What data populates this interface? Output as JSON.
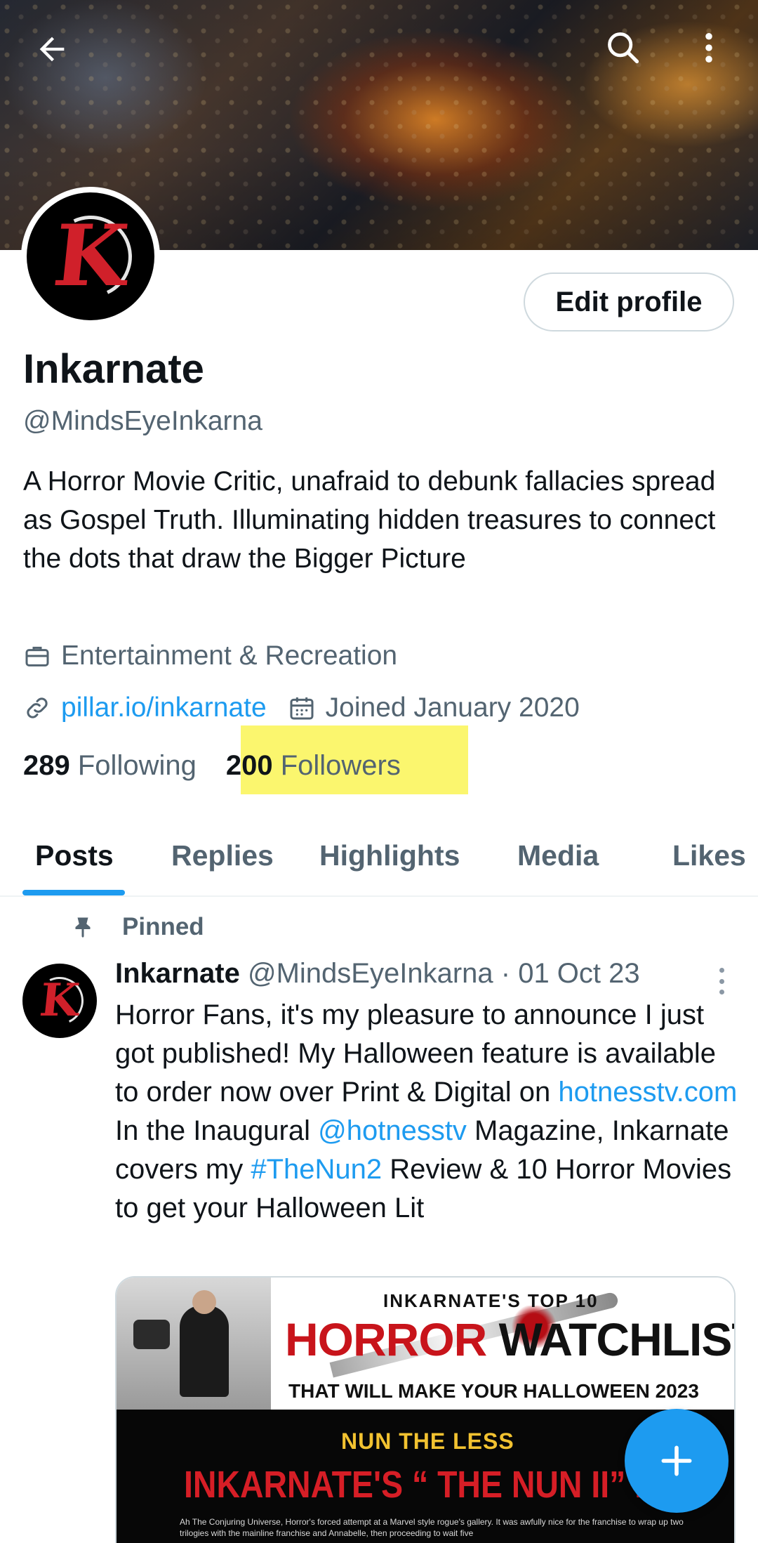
{
  "profile": {
    "name": "Inkarnate",
    "handle": "@MindsEyeInkarna",
    "bio": "A Horror Movie Critic, unafraid to debunk fallacies spread as Gospel Truth. Illuminating hidden treasures to connect the dots that draw the Bigger Picture",
    "category": "Entertainment & Recreation",
    "website": "pillar.io/inkarnate",
    "joined": "Joined January 2020",
    "following_count": "289",
    "following_label": "Following",
    "followers_count": "200",
    "followers_label": "Followers",
    "edit_button": "Edit profile",
    "avatar_letter": "K"
  },
  "tabs": [
    "Posts",
    "Replies",
    "Highlights",
    "Media",
    "Likes"
  ],
  "active_tab": "Posts",
  "post": {
    "pinned_label": "Pinned",
    "author_name": "Inkarnate",
    "author_handle": "@MindsEyeInkarna",
    "date": "· 01 Oct 23",
    "text_1": "Horror Fans, it's my pleasure to announce I just got published!  My Halloween feature is available to order now over Print & Digital on ",
    "link_1": "hotnesstv.com",
    "text_2": " In the Inaugural ",
    "link_2": "@hotnesstv",
    "text_3": " Magazine, Inkarnate covers my ",
    "link_3": "#TheNun2",
    "text_4": " Review & 10 Horror Movies to get your Halloween Lit"
  },
  "media": {
    "top_line": "INKARNATE'S TOP 10",
    "headline_red": "HORROR",
    "headline_black": "WATCHLIST",
    "subline": "THAT WILL MAKE YOUR HALLOWEEN 2023",
    "section": "NUN THE LESS",
    "review_title": "INKARNATE'S “ THE NUN II” REV",
    "small_text": "Ah The Conjuring Universe, Horror's forced attempt at a Marvel style rogue's gallery.  It was awfully nice for the franchise to wrap up two trilogies with the mainline franchise and Annabelle, then proceeding to wait five"
  },
  "colors": {
    "accent": "#1d9bf0",
    "highlight": "#fbf66e",
    "secondary_text": "#536471"
  },
  "icons": [
    "back-arrow-icon",
    "search-icon",
    "more-vertical-icon",
    "briefcase-icon",
    "link-icon",
    "calendar-icon",
    "pin-icon",
    "plus-icon"
  ]
}
